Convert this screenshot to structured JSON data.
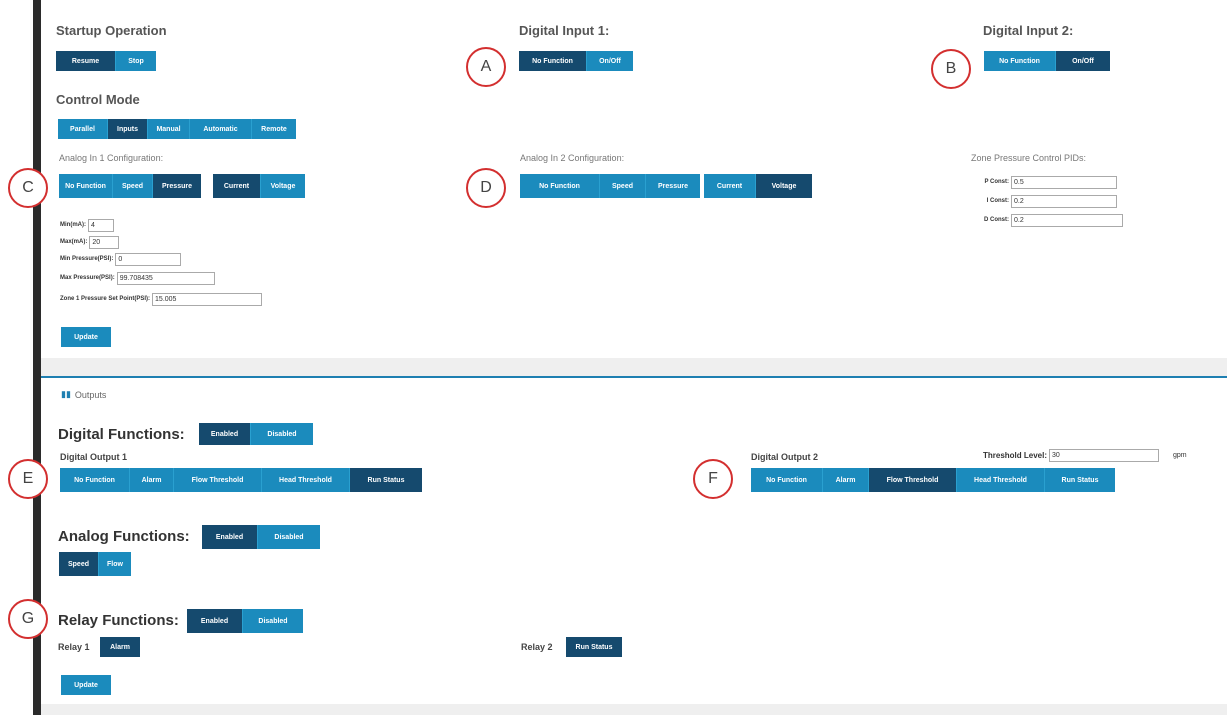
{
  "startup": {
    "title": "Startup Operation",
    "buttons": [
      "Resume",
      "Stop"
    ]
  },
  "digital_input_1": {
    "title": "Digital Input 1:",
    "buttons": [
      "No Function",
      "On/Off"
    ]
  },
  "digital_input_2": {
    "title": "Digital Input 2:",
    "buttons": [
      "No Function",
      "On/Off"
    ]
  },
  "control_mode": {
    "title": "Control Mode",
    "buttons": [
      "Parallel",
      "Inputs",
      "Manual",
      "Automatic",
      "Remote"
    ]
  },
  "analog_in_1": {
    "title": "Analog In 1 Configuration:",
    "func_buttons": [
      "No Function",
      "Speed",
      "Pressure"
    ],
    "type_buttons": [
      "Current",
      "Voltage"
    ],
    "fields": [
      {
        "label": "Min(mA):",
        "value": "4"
      },
      {
        "label": "Max(mA):",
        "value": "20"
      },
      {
        "label": "Min Pressure(PSI):",
        "value": "0"
      },
      {
        "label": "Max Pressure(PSI):",
        "value": "99.708435"
      },
      {
        "label": "Zone 1 Pressure Set Point(PSI):",
        "value": "15.005"
      }
    ],
    "update_label": "Update"
  },
  "analog_in_2": {
    "title": "Analog In 2 Configuration:",
    "func_buttons": [
      "No Function",
      "Speed",
      "Pressure"
    ],
    "type_buttons": [
      "Current",
      "Voltage"
    ]
  },
  "zone_pid": {
    "title": "Zone Pressure Control PIDs:",
    "fields": [
      {
        "label": "P Const:",
        "value": "0.5"
      },
      {
        "label": "I Const:",
        "value": "0.2"
      },
      {
        "label": "D Const:",
        "value": "0.2"
      }
    ]
  },
  "outputs": {
    "tab_label": "Outputs",
    "digital_functions": {
      "title": "Digital Functions:",
      "toggle": [
        "Enabled",
        "Disabled"
      ],
      "output_1": {
        "label": "Digital Output 1",
        "buttons": [
          "No Function",
          "Alarm",
          "Flow Threshold",
          "Head Threshold",
          "Run Status"
        ]
      },
      "output_2": {
        "label": "Digital Output 2",
        "buttons": [
          "No Function",
          "Alarm",
          "Flow Threshold",
          "Head Threshold",
          "Run Status"
        ]
      },
      "threshold": {
        "label": "Threshold Level:",
        "value": "30",
        "unit": "gpm"
      }
    },
    "analog_functions": {
      "title": "Analog Functions:",
      "toggle": [
        "Enabled",
        "Disabled"
      ],
      "buttons": [
        "Speed",
        "Flow"
      ]
    },
    "relay_functions": {
      "title": "Relay Functions:",
      "toggle": [
        "Enabled",
        "Disabled"
      ],
      "relay_1": {
        "label": "Relay 1",
        "button": "Alarm"
      },
      "relay_2": {
        "label": "Relay 2",
        "button": "Run Status"
      }
    },
    "update_label": "Update"
  },
  "markers": [
    "A",
    "B",
    "C",
    "D",
    "E",
    "F",
    "G"
  ],
  "colors": {
    "button": "#1b8bbd",
    "button_active": "#154a6e",
    "marker": "#d32f2f",
    "divider": "#1e7fb1"
  }
}
